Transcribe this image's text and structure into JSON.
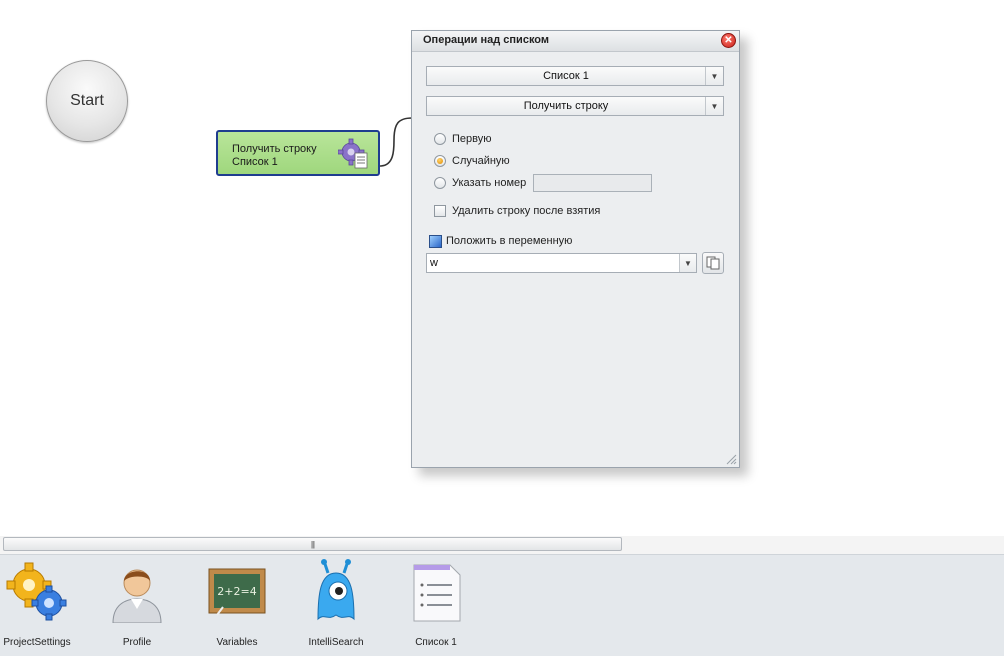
{
  "canvas": {
    "start_label": "Start",
    "action_node": {
      "line1": "Получить строку",
      "line2": "Список 1"
    }
  },
  "dialog": {
    "title": "Операции над списком",
    "close_glyph": "✕",
    "list_select": "Список 1",
    "operation_select": "Получить строку",
    "radios": [
      {
        "label": "Первую",
        "checked": false
      },
      {
        "label": "Случайную",
        "checked": true
      },
      {
        "label": "Указать номер",
        "checked": false
      }
    ],
    "number_value": "",
    "delete_checkbox_label": "Удалить строку после взятия",
    "delete_checked": false,
    "put_to_variable_label": "Положить в переменную",
    "variable_value": "w",
    "dropdown_glyph": "▼"
  },
  "scrollbar": {
    "grip": "|||"
  },
  "toolbar": {
    "items": [
      {
        "label": "ProjectSettings",
        "icon": "gears-icon"
      },
      {
        "label": "Profile",
        "icon": "person-icon"
      },
      {
        "label": "Variables",
        "icon": "chalkboard-icon"
      },
      {
        "label": "IntelliSearch",
        "icon": "blue-monster-icon"
      },
      {
        "label": "Список 1",
        "icon": "list-document-icon"
      }
    ],
    "chalkboard_text": "2+2=4"
  },
  "colors": {
    "node_border": "#1f3d8f",
    "node_fill": "#b9e59a",
    "close_red": "#c9201a",
    "radio_selected": "#e08a00"
  }
}
